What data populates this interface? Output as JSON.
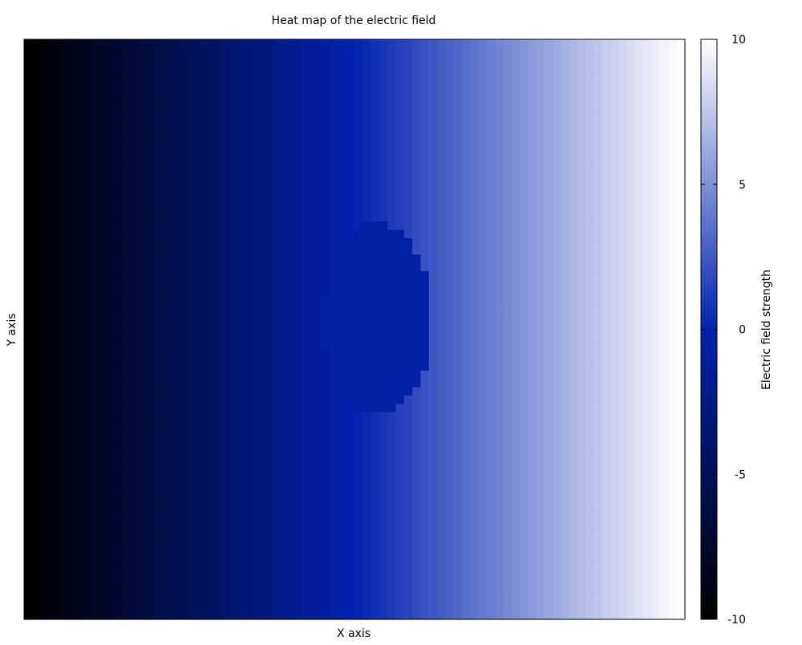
{
  "chart_data": {
    "type": "heatmap",
    "title": "Heat map of the electric field",
    "xlabel": "X axis",
    "ylabel": "Y axis",
    "colorbar": {
      "label": "Electric field strength",
      "range": [
        -10,
        10
      ],
      "ticks": [
        -10,
        -5,
        0,
        5,
        10
      ],
      "tick_labels": [
        "-10",
        "-5",
        "0",
        "5",
        "10"
      ],
      "colormap_stops": [
        {
          "value": -10,
          "color": "#000000"
        },
        {
          "value": 0,
          "color": "#0022b0"
        },
        {
          "value": 10,
          "color": "#ffffff"
        }
      ]
    },
    "field": {
      "left_value": -10,
      "right_value": 10,
      "ellipse_value": -0.6
    },
    "grid": false,
    "x_ticks_shown": false,
    "y_ticks_shown": false
  }
}
